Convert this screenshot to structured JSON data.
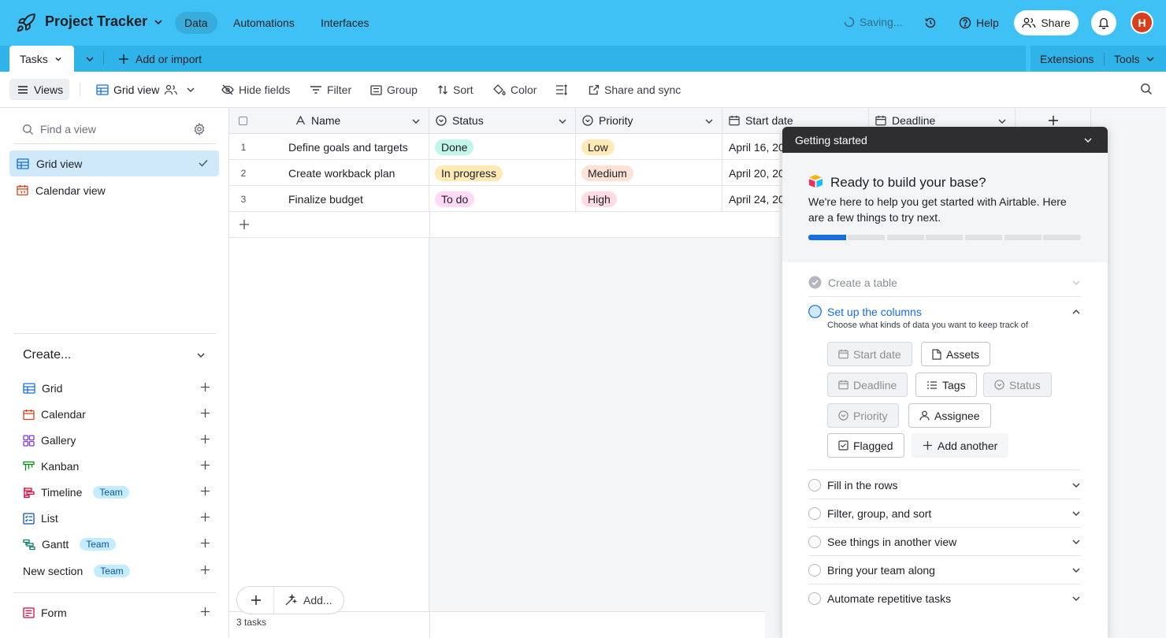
{
  "header": {
    "base_name": "Project Tracker",
    "nav": [
      "Data",
      "Automations",
      "Interfaces"
    ],
    "saving": "Saving...",
    "help": "Help",
    "share": "Share",
    "avatar_initial": "H"
  },
  "tabbar": {
    "table_tab": "Tasks",
    "add_import": "Add or import",
    "extensions": "Extensions",
    "tools": "Tools"
  },
  "viewbar": {
    "views": "Views",
    "grid_view": "Grid view",
    "hide_fields": "Hide fields",
    "filter": "Filter",
    "group": "Group",
    "sort": "Sort",
    "color": "Color",
    "share_sync": "Share and sync"
  },
  "sidebar": {
    "find_placeholder": "Find a view",
    "views": [
      "Grid view",
      "Calendar view"
    ],
    "create_heading": "Create...",
    "create_items": [
      {
        "label": "Grid",
        "badge": ""
      },
      {
        "label": "Calendar",
        "badge": ""
      },
      {
        "label": "Gallery",
        "badge": ""
      },
      {
        "label": "Kanban",
        "badge": ""
      },
      {
        "label": "Timeline",
        "badge": "Team"
      },
      {
        "label": "List",
        "badge": ""
      },
      {
        "label": "Gantt",
        "badge": "Team"
      },
      {
        "label": "New section",
        "badge": "Team"
      }
    ],
    "form": "Form"
  },
  "grid": {
    "columns": [
      "Name",
      "Status",
      "Priority",
      "Start date",
      "Deadline"
    ],
    "rows": [
      {
        "num": "1",
        "name": "Define goals and targets",
        "status": "Done",
        "priority": "Low",
        "start": "April 16, 20"
      },
      {
        "num": "2",
        "name": "Create workback plan",
        "status": "In progress",
        "priority": "Medium",
        "start": "April 20, 20"
      },
      {
        "num": "3",
        "name": "Finalize budget",
        "status": "To do",
        "priority": "High",
        "start": "April 24, 20"
      }
    ],
    "add_label": "Add...",
    "record_count": "3 tasks"
  },
  "panel": {
    "title": "Getting started",
    "hero_title": "Ready to build your base?",
    "hero_sub": "We're here to help you get started with Airtable. Here are a few things to try next.",
    "progress_fraction": 0.143,
    "steps": {
      "create_table": "Create a table",
      "setup_columns": "Set up the columns",
      "setup_desc": "Choose what kinds of data you want to keep track of",
      "fill_rows": "Fill in the rows",
      "filter_group": "Filter, group, and sort",
      "another_view": "See things in another view",
      "team_along": "Bring your team along",
      "automate": "Automate repetitive tasks"
    },
    "chips": {
      "start_date": "Start date",
      "assets": "Assets",
      "deadline": "Deadline",
      "tags": "Tags",
      "status": "Status",
      "priority": "Priority",
      "assignee": "Assignee",
      "flagged": "Flagged",
      "add_another": "Add another"
    }
  },
  "colors": {
    "header_bg": "#3fc1f5",
    "done": "#c2f5e9",
    "in_progress": "#ffeab6",
    "todo": "#ffdaf6",
    "low": "#ffeab6",
    "medium": "#fee2d5",
    "high": "#ffdce5"
  }
}
